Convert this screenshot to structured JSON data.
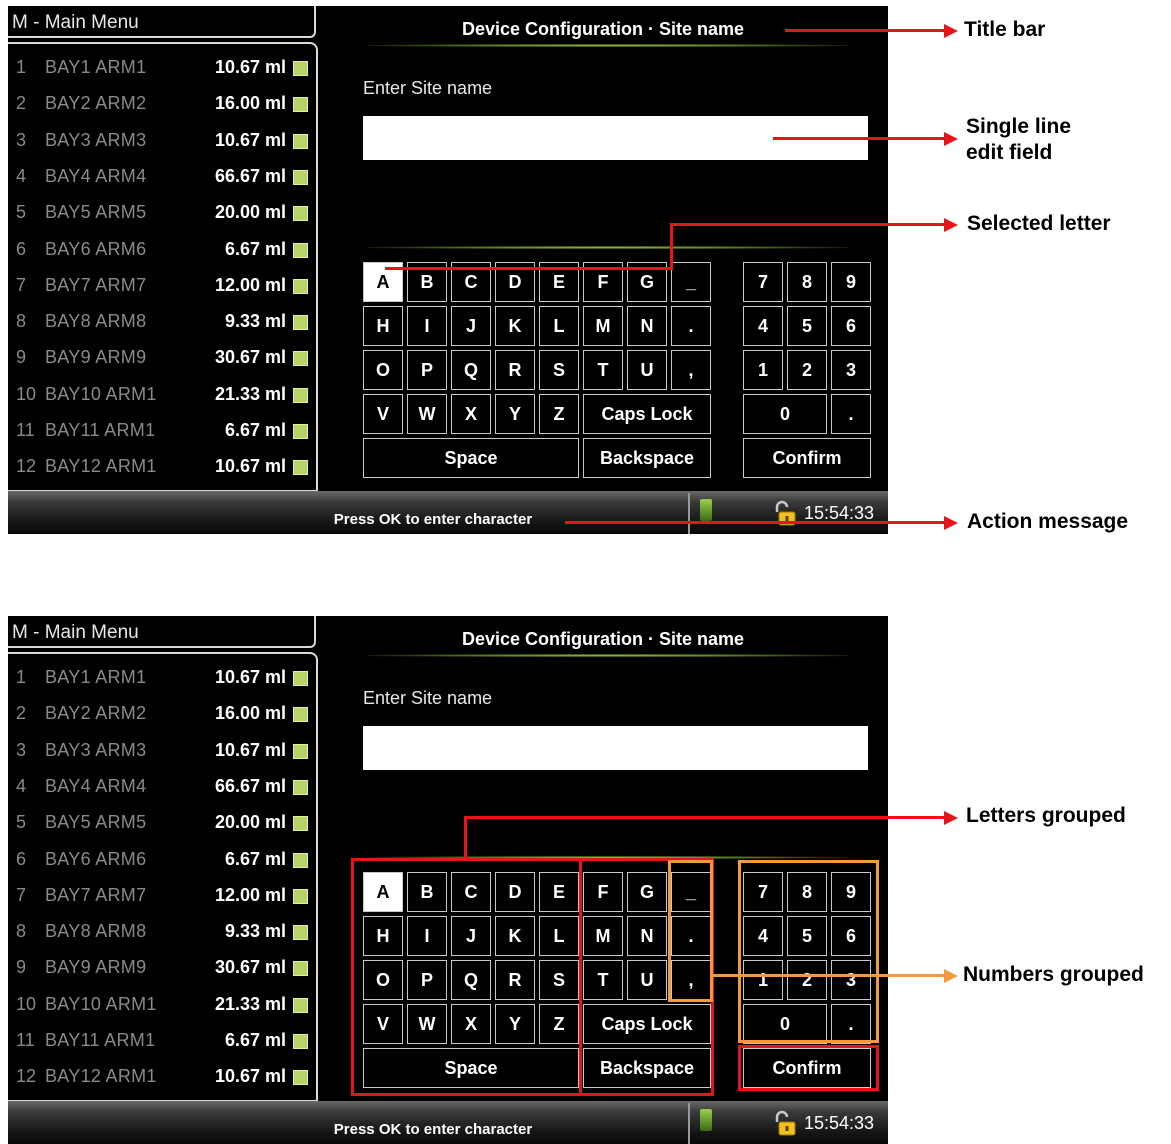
{
  "screen": {
    "menu_title": "M - Main Menu",
    "window_title": "Device Configuration · Site name",
    "prompt": "Enter Site name",
    "input_value": "",
    "list": [
      {
        "num": "1",
        "name": "BAY1 ARM1",
        "value": "10.67 ml"
      },
      {
        "num": "2",
        "name": "BAY2 ARM2",
        "value": "16.00 ml"
      },
      {
        "num": "3",
        "name": "BAY3 ARM3",
        "value": "10.67 ml"
      },
      {
        "num": "4",
        "name": "BAY4 ARM4",
        "value": "66.67 ml"
      },
      {
        "num": "5",
        "name": "BAY5 ARM5",
        "value": "20.00 ml"
      },
      {
        "num": "6",
        "name": "BAY6 ARM6",
        "value": "6.67 ml"
      },
      {
        "num": "7",
        "name": "BAY7 ARM7",
        "value": "12.00 ml"
      },
      {
        "num": "8",
        "name": "BAY8 ARM8",
        "value": "9.33 ml"
      },
      {
        "num": "9",
        "name": "BAY9 ARM9",
        "value": "30.67 ml"
      },
      {
        "num": "10",
        "name": "BAY10 ARM1",
        "value": "21.33 ml"
      },
      {
        "num": "11",
        "name": "BAY11 ARM1",
        "value": "6.67 ml"
      },
      {
        "num": "12",
        "name": "BAY12 ARM1",
        "value": "10.67 ml"
      }
    ],
    "keys": {
      "letters": [
        [
          "A",
          "B",
          "C",
          "D",
          "E",
          "F",
          "G",
          "_"
        ],
        [
          "H",
          "I",
          "J",
          "K",
          "L",
          "M",
          "N",
          "."
        ],
        [
          "O",
          "P",
          "Q",
          "R",
          "S",
          "T",
          "U",
          ","
        ],
        [
          "V",
          "W",
          "X",
          "Y",
          "Z"
        ]
      ],
      "numbers": [
        [
          "7",
          "8",
          "9"
        ],
        [
          "4",
          "5",
          "6"
        ],
        [
          "1",
          "2",
          "3"
        ]
      ],
      "zero": "0",
      "dot": ".",
      "caps_lock": "Caps Lock",
      "space": "Space",
      "backspace": "Backspace",
      "confirm": "Confirm",
      "selected_key": "A"
    },
    "status_message": "Press OK to enter character",
    "clock": "15:54:33"
  },
  "annotations": {
    "top": {
      "title_bar": "Title bar",
      "edit_field_line1": "Single line",
      "edit_field_line2": "edit field",
      "selected_letter": "Selected letter",
      "action_message": "Action message"
    },
    "bottom": {
      "letters_grouped": "Letters grouped",
      "numbers_grouped": "Numbers grouped"
    }
  },
  "colors": {
    "callout_red": "#e8141c",
    "callout_orange": "#f39a3c",
    "status_square": "#b8d468"
  }
}
